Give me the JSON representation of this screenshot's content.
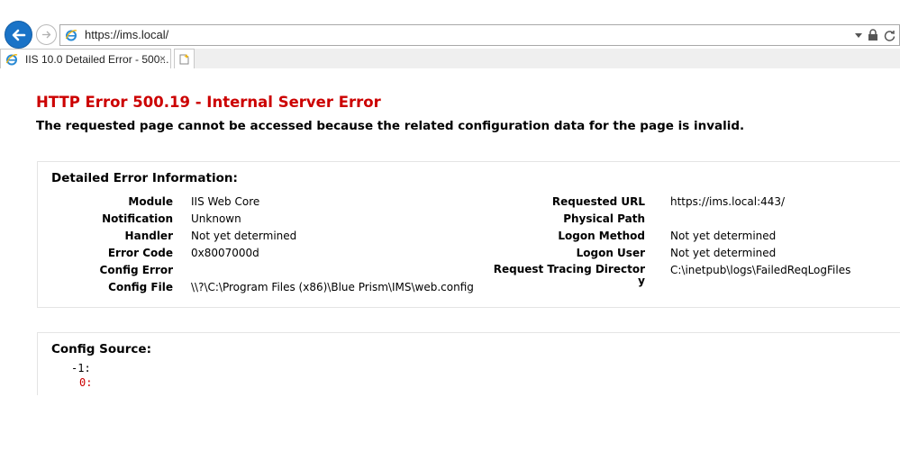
{
  "browser": {
    "url": "https://ims.local/",
    "tab_title": "IIS 10.0 Detailed Error - 500...",
    "tab_close": "×"
  },
  "page": {
    "title": "HTTP Error 500.19 - Internal Server Error",
    "subtitle": "The requested page cannot be accessed because the related configuration data for the page is invalid.",
    "detail": {
      "heading": "Detailed Error Information:",
      "left": [
        {
          "label": "Module",
          "value": "IIS Web Core"
        },
        {
          "label": "Notification",
          "value": "Unknown"
        },
        {
          "label": "Handler",
          "value": "Not yet determined"
        },
        {
          "label": "Error Code",
          "value": "0x8007000d"
        },
        {
          "label": "Config Error",
          "value": ""
        },
        {
          "label": "Config File",
          "value": "\\\\?\\C:\\Program Files (x86)\\Blue Prism\\IMS\\web.config"
        }
      ],
      "right": [
        {
          "label": "Requested URL",
          "value": "https://ims.local:443/"
        },
        {
          "label": "Physical Path",
          "value": ""
        },
        {
          "label": "Logon Method",
          "value": "Not yet determined"
        },
        {
          "label": "Logon User",
          "value": "Not yet determined"
        },
        {
          "label": "Request Tracing Director\ny",
          "value": "C:\\inetpub\\logs\\FailedReqLogFiles"
        }
      ]
    },
    "config_source": {
      "heading": "Config Source:",
      "line1": "-1:",
      "line2": "0:"
    }
  },
  "colors": {
    "error_red": "#cc0000",
    "back_button_blue": "#1a73c7"
  },
  "icons": [
    "back-arrow-icon",
    "forward-arrow-icon",
    "ie-page-icon",
    "dropdown-arrow-icon",
    "lock-icon",
    "refresh-icon",
    "new-tab-icon"
  ]
}
